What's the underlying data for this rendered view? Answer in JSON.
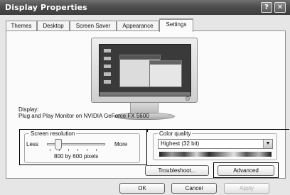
{
  "window": {
    "title": "Display Properties"
  },
  "titlebar": {
    "help_label": "?",
    "close_label": "✕"
  },
  "tabs": [
    {
      "label": "Themes"
    },
    {
      "label": "Desktop"
    },
    {
      "label": "Screen Saver"
    },
    {
      "label": "Appearance"
    },
    {
      "label": "Settings"
    }
  ],
  "display": {
    "label": "Display:",
    "value": "Plug and Play Monitor on NVIDIA GeForce FX 5600"
  },
  "resolution": {
    "legend": "Screen resolution",
    "less_label": "Less",
    "more_label": "More",
    "value_text": "800 by 600 pixels",
    "slider_position": 0.2
  },
  "color_quality": {
    "legend": "Color quality",
    "selected": "Highest (32 bit)"
  },
  "buttons": {
    "troubleshoot": "Troubleshoot...",
    "advanced": "Advanced",
    "ok": "OK",
    "cancel": "Cancel",
    "apply": "Apply"
  }
}
